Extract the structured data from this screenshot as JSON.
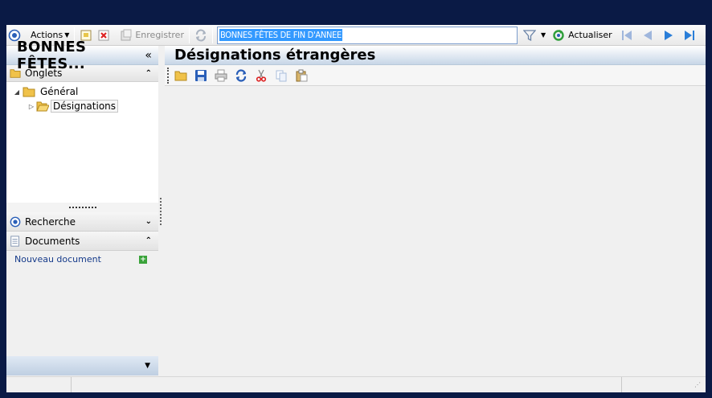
{
  "toolbar": {
    "actions_label": "Actions",
    "save_label": "Enregistrer",
    "search_value": "BONNES FÊTES DE FIN D'ANNEE",
    "refresh_label": "Actualiser"
  },
  "left_panel": {
    "title": "BONNES FÊTES...",
    "collapse_glyph": "«",
    "tabs_header": "Onglets",
    "tree": [
      {
        "label": "Général",
        "expanded": true
      },
      {
        "label": "Désignations",
        "expanded": false,
        "selected": true
      }
    ],
    "search_header": "Recherche",
    "documents_header": "Documents",
    "new_document_link": "Nouveau document"
  },
  "right_panel": {
    "title": "Désignations étrangères"
  },
  "icons": [
    "target-icon",
    "new-icon",
    "delete-icon",
    "save-icon",
    "refresh-icon",
    "filter-icon",
    "nav-first-icon",
    "nav-prev-icon",
    "nav-next-icon",
    "nav-last-icon",
    "folder-icon",
    "print-icon",
    "cut-icon",
    "copy-icon",
    "paste-icon"
  ],
  "colors": {
    "desktop": "#0a1a45",
    "header_gradient": "#c7d6e7",
    "selection": "#3399ff",
    "nav_blue": "#2a7ed8"
  }
}
